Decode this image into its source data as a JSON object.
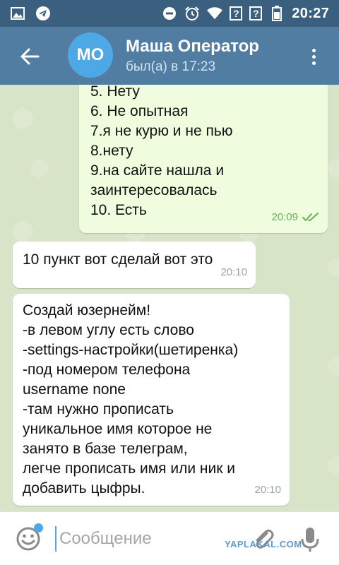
{
  "status_bar": {
    "time": "20:27",
    "unknown_sim_1": "?",
    "unknown_sim_2": "?"
  },
  "header": {
    "avatar_initials": "МО",
    "contact_name": "Маша Оператор",
    "contact_status": "был(а) в 17:23"
  },
  "messages": [
    {
      "direction": "outgoing",
      "lines": [
        "5. Нету",
        "6. Не опытная",
        "7.я не курю и не пью",
        "8.нету",
        "9.на сайте нашла и",
        "заинтересовалась",
        "10. Есть"
      ],
      "time": "20:09",
      "read_receipt": "double-check-icon"
    },
    {
      "direction": "incoming",
      "lines": [
        "10 пункт вот сделай вот это"
      ],
      "time": "20:10"
    },
    {
      "direction": "incoming",
      "lines": [
        "Создай юзернейм!",
        "-в левом углу есть слово",
        "-settings-настройки(шетиренка)",
        "-под номером телефона",
        "username none",
        "-там нужно прописать",
        "уникальное имя которое не",
        "занято в базе телеграм,",
        "легче прописать имя или ник и",
        "добавить цыфры."
      ],
      "time": "20:10"
    }
  ],
  "input": {
    "placeholder": "Сообщение",
    "value": ""
  },
  "watermark": "YAPLAKAL.COM",
  "colors": {
    "header": "#517da2",
    "status_bar": "#3b5f7f",
    "outgoing_bubble": "#effdde",
    "incoming_bubble": "#ffffff",
    "accent": "#4fa8e6",
    "read_check": "#6aaf5e"
  }
}
